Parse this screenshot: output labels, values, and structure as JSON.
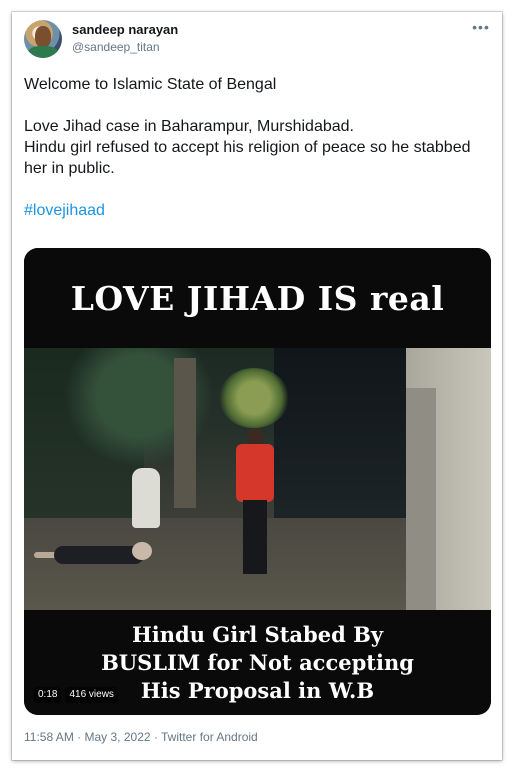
{
  "user": {
    "display_name": "sandeep narayan",
    "handle": "@sandeep_titan"
  },
  "menu": {
    "more_label": "•••"
  },
  "tweet": {
    "line1": "Welcome to Islamic State of Bengal",
    "line2": "Love Jihad case in Baharampur, Murshidabad.",
    "line3": "Hindu girl refused to accept his religion of peace so he stabbed her in public.",
    "hashtag": "#lovejihaad"
  },
  "media": {
    "top_caption": "LOVE JIHAD IS real",
    "bottom_caption": [
      "Hindu Girl Stabed By",
      "BUSLIM for Not accepting",
      "His Proposal in W.B"
    ],
    "duration": "0:18",
    "views": "416 views"
  },
  "meta": {
    "time": "11:58 AM",
    "date": "May 3, 2022",
    "client": "Twitter for Android",
    "separator": "·"
  },
  "colors": {
    "link": "#1b95e0",
    "secondary_text": "#657786",
    "primary_text": "#14171a"
  }
}
